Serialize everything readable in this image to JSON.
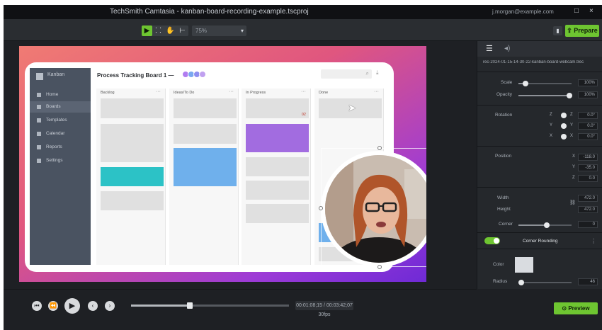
{
  "window": {
    "title": "TechSmith Camtasia - kanban-board-recording-example.tscproj",
    "user": "j.morgan@example.com",
    "minimize_glyph": "□",
    "close_glyph": "×"
  },
  "toolbar": {
    "tools": [
      {
        "name": "select-tool-icon",
        "glyph": "▶"
      },
      {
        "name": "marquee-tool-icon",
        "glyph": "⸬"
      },
      {
        "name": "hand-tool-icon",
        "glyph": "✋"
      },
      {
        "name": "crop-tool-icon",
        "glyph": "⊢"
      }
    ],
    "zoom_value": "75%",
    "zoom_caret": "▾",
    "square_glyph": "▮",
    "prepare_label": "⇪ Prepare"
  },
  "canvas": {
    "app": {
      "logo_text": "Kanban",
      "board_title": "Process Tracking Board 1 —",
      "nav": [
        {
          "label": "Home"
        },
        {
          "label": "Boards"
        },
        {
          "label": "Templates"
        },
        {
          "label": "Calendar"
        },
        {
          "label": "Reports"
        },
        {
          "label": "Settings"
        }
      ],
      "avatar_colors": [
        "#b07cf0",
        "#7aa8f0",
        "#8e8ef0",
        "#c0a0f0"
      ],
      "columns": [
        {
          "title": "Backlog",
          "menu": "···"
        },
        {
          "title": "Ideas/To Do",
          "menu": "···"
        },
        {
          "title": "In Progress",
          "menu": "···"
        },
        {
          "title": "Done",
          "menu": "···"
        }
      ],
      "overdue_count": "02",
      "search_icon_glyph": "⌕",
      "download_icon_glyph": "⤓"
    },
    "cursor_glyph": "➤",
    "accent_colors": {
      "teal": "#2cc2c6",
      "blue": "#6fb0ec",
      "purple": "#a26ce0"
    }
  },
  "properties": {
    "filename": "rec-2024-01-15-14-30-22-kanban-board-webcam.trec",
    "tab_icon_glyph": "☰",
    "audio_icon_glyph": "◂)",
    "scale_label": "Scale",
    "scale_value": "100%",
    "opacity_label": "Opacity",
    "opacity_value": "100%",
    "rotation_label": "Rotation",
    "rotation_values": [
      "0.0°",
      "0.0°",
      "0.0°"
    ],
    "axis_labels": [
      "Z",
      "Y",
      "X"
    ],
    "position_label": "Position",
    "position_values": [
      "-118.0",
      "-35.0",
      "0.0"
    ],
    "width_label": "Width",
    "width_value": "472.0",
    "height_label": "Height",
    "height_value": "472.0",
    "corner_label": "Corner",
    "corner_value": "0",
    "link_glyph": "⛓",
    "corner_rounding_label": "Corner Rounding",
    "corner_rounding_enabled": true,
    "color_label": "Color",
    "radius_label": "Radius",
    "radius_value": "46",
    "panel_menu_glyph": "⋮"
  },
  "playback": {
    "buttons": [
      "⏮",
      "⏪",
      "▶",
      "‹",
      "›"
    ],
    "timecode": "00:01:08;15 / 00:03:42;07  30fps",
    "preview_label": "⊙ Preview",
    "progress_fraction": 0.37
  }
}
